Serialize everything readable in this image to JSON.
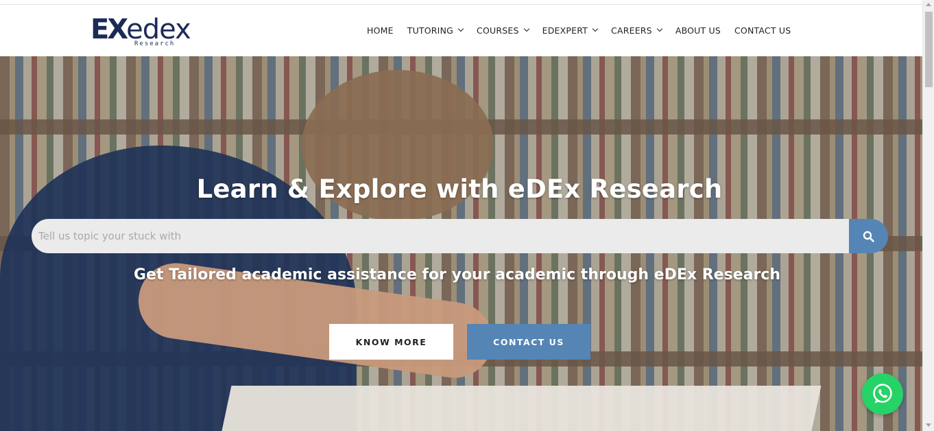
{
  "logo": {
    "brand_prefix": "EX",
    "brand_name": "edex",
    "brand_sub": "Research"
  },
  "nav": {
    "items": [
      {
        "label": "HOME",
        "dropdown": false
      },
      {
        "label": "TUTORING",
        "dropdown": true
      },
      {
        "label": "COURSES",
        "dropdown": true
      },
      {
        "label": "EDEXPERT",
        "dropdown": true
      },
      {
        "label": "CAREERS",
        "dropdown": true
      },
      {
        "label": "ABOUT US",
        "dropdown": false
      },
      {
        "label": "CONTACT US",
        "dropdown": false
      }
    ]
  },
  "hero": {
    "title": "Learn & Explore with eDEx Research",
    "search_placeholder": "Tell us topic your stuck with",
    "search_icon": "search-icon",
    "subtitle": "Get Tailored academic assistance for your academic through eDEx Research",
    "know_more_label": "KNOW MORE",
    "contact_label": "CONTACT US"
  },
  "colors": {
    "accent": "#5585b5",
    "brand": "#1b2b58",
    "whatsapp": "#25d366"
  },
  "floating": {
    "whatsapp_icon": "whatsapp-icon"
  }
}
